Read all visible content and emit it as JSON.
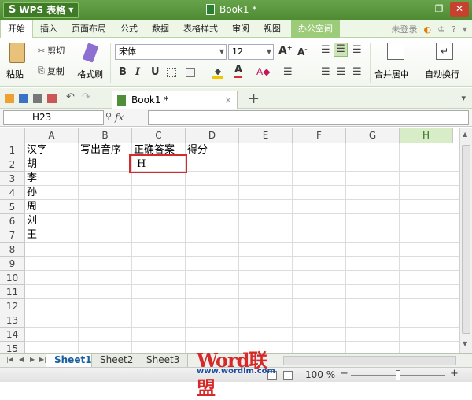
{
  "titlebar": {
    "app_name": "WPS 表格",
    "doc_title": "Book1 *"
  },
  "menu": {
    "tabs": [
      "开始",
      "插入",
      "页面布局",
      "公式",
      "数据",
      "表格样式",
      "审阅",
      "视图"
    ],
    "special_tab": "办公空间",
    "login": "未登录",
    "help": "?"
  },
  "ribbon": {
    "paste": "粘贴",
    "cut": "剪切",
    "copy": "复制",
    "format_painter": "格式刷",
    "font_name": "宋体",
    "font_size": "12",
    "merge_center": "合并居中",
    "wrap_text": "自动换行"
  },
  "doc_tab": {
    "label": "Book1 *",
    "new_tab": "+"
  },
  "formula_bar": {
    "name_box": "H23",
    "fx": "fx"
  },
  "columns": [
    "A",
    "B",
    "C",
    "D",
    "E",
    "F",
    "G",
    "H"
  ],
  "selected_column": "H",
  "rows": [
    "1",
    "2",
    "3",
    "4",
    "5",
    "6",
    "7",
    "8",
    "9",
    "10",
    "11",
    "12",
    "13",
    "14",
    "15"
  ],
  "cells": {
    "A1": "汉字",
    "B1": "写出音序",
    "C1": "正确答案",
    "D1": "得分",
    "A2": "胡",
    "A3": "李",
    "A4": "孙",
    "A5": "周",
    "A6": "刘",
    "A7": "王",
    "C2": "H"
  },
  "sheets": [
    "Sheet1",
    "Sheet2",
    "Sheet3"
  ],
  "active_sheet": "Sheet1",
  "status": {
    "zoom": "100 %",
    "zoom_fraction": 0.5
  },
  "watermark": {
    "brand": "Word联盟",
    "url": "www.wordlm.com"
  },
  "colors": {
    "accent": "#4d8a32",
    "active_cell_border": "#d62a2a"
  }
}
